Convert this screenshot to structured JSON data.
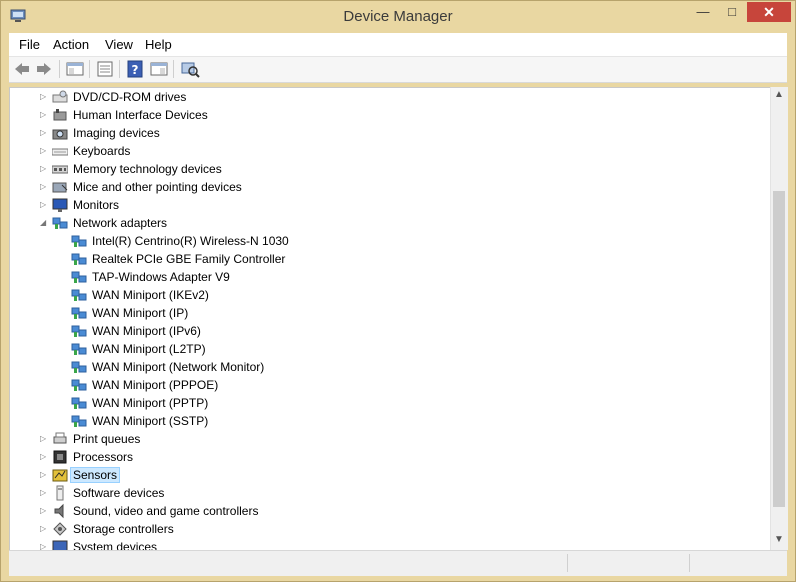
{
  "window": {
    "title": "Device Manager",
    "minimize_glyph": "—",
    "maximize_glyph": "□",
    "close_glyph": "✕"
  },
  "menu": {
    "items": [
      "File",
      "Action",
      "View",
      "Help"
    ]
  },
  "toolbar": {
    "buttons": [
      "back-arrow-icon",
      "forward-arrow-icon",
      "show-hide-tree-icon",
      "properties-icon",
      "help-icon",
      "action-pane-icon",
      "scan-hardware-icon"
    ]
  },
  "tree": {
    "rows": [
      {
        "label": "DVD/CD-ROM drives",
        "level": 0,
        "expanded": false,
        "icon": "dvd-drive-icon"
      },
      {
        "label": "Human Interface Devices",
        "level": 0,
        "expanded": false,
        "icon": "hid-icon"
      },
      {
        "label": "Imaging devices",
        "level": 0,
        "expanded": false,
        "icon": "camera-icon"
      },
      {
        "label": "Keyboards",
        "level": 0,
        "expanded": false,
        "icon": "keyboard-icon"
      },
      {
        "label": "Memory technology devices",
        "level": 0,
        "expanded": false,
        "icon": "memory-icon"
      },
      {
        "label": "Mice and other pointing devices",
        "level": 0,
        "expanded": false,
        "icon": "mouse-icon"
      },
      {
        "label": "Monitors",
        "level": 0,
        "expanded": false,
        "icon": "monitor-icon"
      },
      {
        "label": "Network adapters",
        "level": 0,
        "expanded": true,
        "icon": "network-adapter-icon"
      },
      {
        "label": "Intel(R) Centrino(R) Wireless-N 1030",
        "level": 1,
        "icon": "network-adapter-icon"
      },
      {
        "label": "Realtek PCIe GBE Family Controller",
        "level": 1,
        "icon": "network-adapter-icon"
      },
      {
        "label": "TAP-Windows Adapter V9",
        "level": 1,
        "icon": "network-adapter-icon"
      },
      {
        "label": "WAN Miniport (IKEv2)",
        "level": 1,
        "icon": "network-adapter-icon"
      },
      {
        "label": "WAN Miniport (IP)",
        "level": 1,
        "icon": "network-adapter-icon"
      },
      {
        "label": "WAN Miniport (IPv6)",
        "level": 1,
        "icon": "network-adapter-icon"
      },
      {
        "label": "WAN Miniport (L2TP)",
        "level": 1,
        "icon": "network-adapter-icon"
      },
      {
        "label": "WAN Miniport (Network Monitor)",
        "level": 1,
        "icon": "network-adapter-icon"
      },
      {
        "label": "WAN Miniport (PPPOE)",
        "level": 1,
        "icon": "network-adapter-icon"
      },
      {
        "label": "WAN Miniport (PPTP)",
        "level": 1,
        "icon": "network-adapter-icon"
      },
      {
        "label": "WAN Miniport (SSTP)",
        "level": 1,
        "icon": "network-adapter-icon"
      },
      {
        "label": "Print queues",
        "level": 0,
        "expanded": false,
        "icon": "printer-icon"
      },
      {
        "label": "Processors",
        "level": 0,
        "expanded": false,
        "icon": "processor-icon"
      },
      {
        "label": "Sensors",
        "level": 0,
        "expanded": false,
        "icon": "sensor-icon",
        "selected": true
      },
      {
        "label": "Software devices",
        "level": 0,
        "expanded": false,
        "icon": "software-device-icon"
      },
      {
        "label": "Sound, video and game controllers",
        "level": 0,
        "expanded": false,
        "icon": "speaker-icon"
      },
      {
        "label": "Storage controllers",
        "level": 0,
        "expanded": false,
        "icon": "storage-controller-icon"
      },
      {
        "label": "System devices",
        "level": 0,
        "expanded": false,
        "icon": "system-device-icon"
      }
    ]
  },
  "colors": {
    "title_bar": "#e9d7a2",
    "close_button": "#c7453b",
    "selection_fill": "#cce8ff",
    "selection_border": "#99d1ff"
  }
}
